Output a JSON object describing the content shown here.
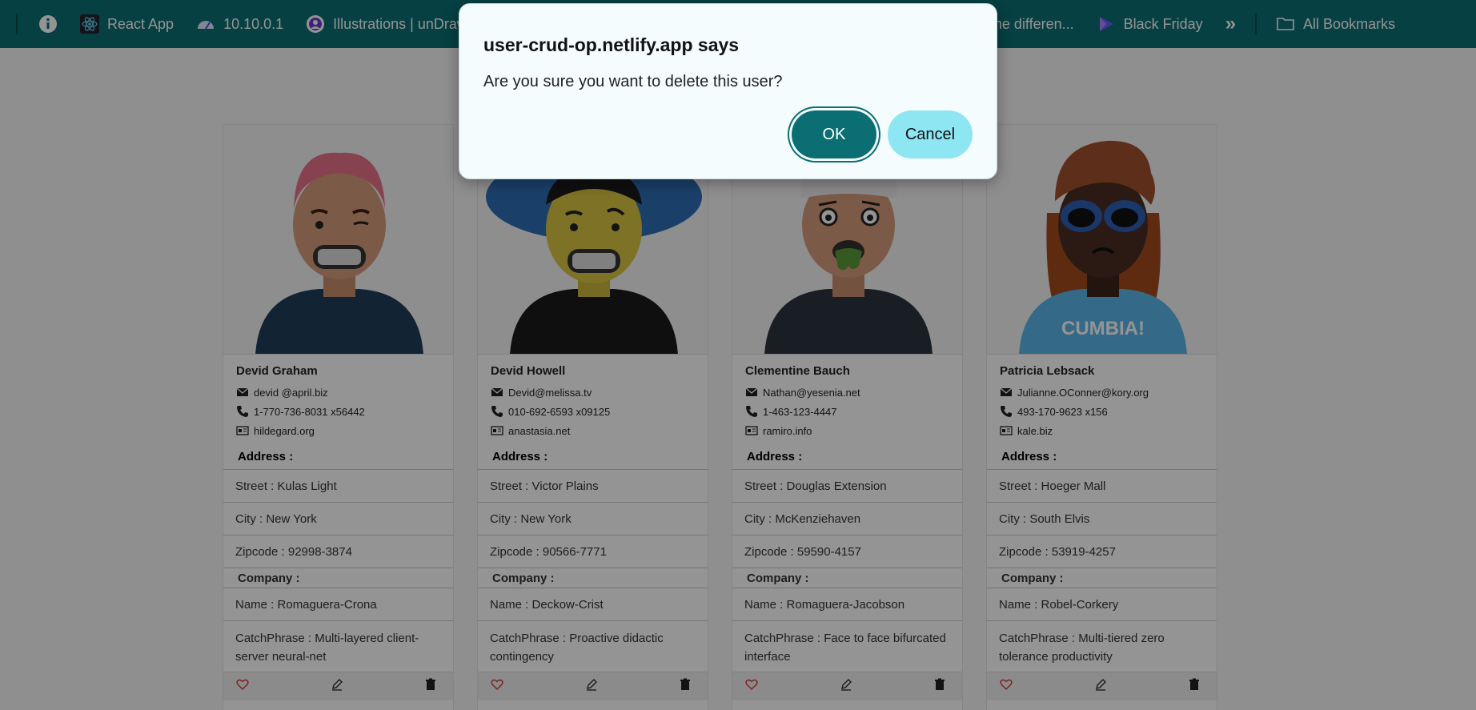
{
  "bookmarks": {
    "items": [
      {
        "label": "",
        "icon": "info-icon"
      },
      {
        "label": "React App",
        "icon": "react-icon"
      },
      {
        "label": "10.10.0.1",
        "icon": "router-icon"
      },
      {
        "label": "Illustrations | unDraw",
        "icon": "undraw-icon"
      },
      {
        "label": "What is the differen...",
        "icon": "page-icon"
      },
      {
        "label": "Black Friday",
        "icon": "play-icon"
      },
      {
        "label": "»",
        "icon": "more-icon"
      },
      {
        "label": "All Bookmarks",
        "icon": "folder-icon"
      }
    ]
  },
  "dialog": {
    "title": "user-crud-op.netlify.app says",
    "message": "Are you sure you want to delete this user?",
    "ok_label": "OK",
    "cancel_label": "Cancel"
  },
  "labels": {
    "address": "Address :",
    "company": "Company :"
  },
  "users": [
    {
      "name": "Devid Graham",
      "email": "devid @april.biz",
      "phone": "1-770-736-8031 x56442",
      "website": "hildegard.org",
      "street": "Street : Kulas Light",
      "city": "City : New York",
      "zipcode": "Zipcode : 92998-3874",
      "company_name": "Name : Romaguera-Crona",
      "catchphrase": "CatchPhrase : Multi-layered client-server neural-net"
    },
    {
      "name": "Devid Howell",
      "email": "Devid@melissa.tv",
      "phone": "010-692-6593 x09125",
      "website": "anastasia.net",
      "street": "Street : Victor Plains",
      "city": "City : New York",
      "zipcode": "Zipcode : 90566-7771",
      "company_name": "Name : Deckow-Crist",
      "catchphrase": "CatchPhrase : Proactive didactic contingency"
    },
    {
      "name": "Clementine Bauch",
      "email": "Nathan@yesenia.net",
      "phone": "1-463-123-4447",
      "website": "ramiro.info",
      "street": "Street : Douglas Extension",
      "city": "City : McKenziehaven",
      "zipcode": "Zipcode : 59590-4157",
      "company_name": "Name : Romaguera-Jacobson",
      "catchphrase": "CatchPhrase : Face to face bifurcated interface"
    },
    {
      "name": "Patricia Lebsack",
      "email": "Julianne.OConner@kory.org",
      "phone": "493-170-9623 x156",
      "website": "kale.biz",
      "street": "Street : Hoeger Mall",
      "city": "City : South Elvis",
      "zipcode": "Zipcode : 53919-4257",
      "company_name": "Name : Robel-Corkery",
      "catchphrase": "CatchPhrase : Multi-tiered zero tolerance productivity",
      "shirt_text": "CUMBIA!"
    }
  ],
  "colors": {
    "teal": "#0b6e73",
    "cancel": "#8fe6f3",
    "heart": "#e0393e"
  }
}
